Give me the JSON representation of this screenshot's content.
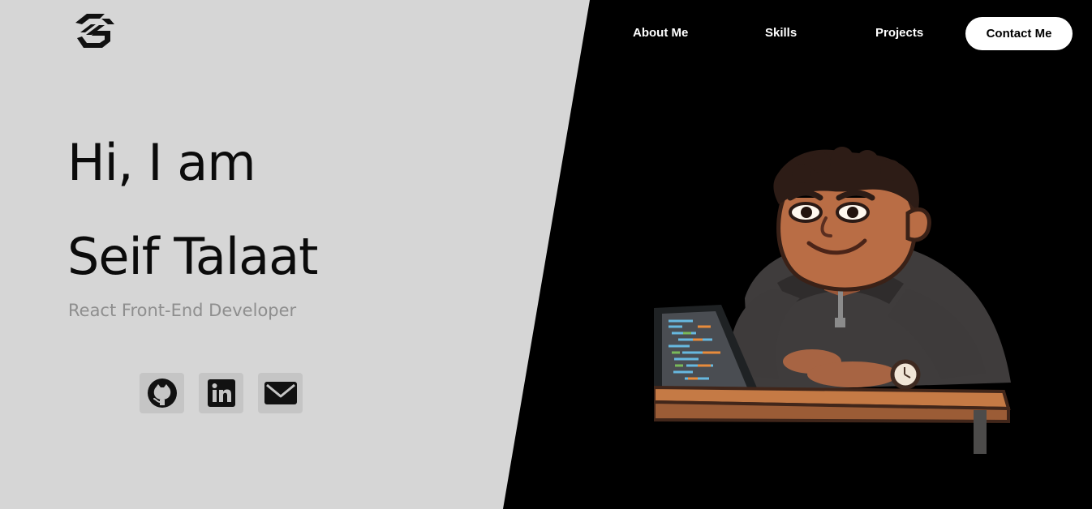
{
  "header": {
    "logo_icon": "tg-monogram-logo-icon",
    "nav": [
      {
        "label": "About Me"
      },
      {
        "label": "Skills"
      },
      {
        "label": "Projects"
      }
    ],
    "contact_label": "Contact Me"
  },
  "hero": {
    "greeting": "Hi, I am",
    "name": "Seif Talaat",
    "role": "React Front-End Developer",
    "socials": [
      {
        "icon": "github-icon"
      },
      {
        "icon": "linkedin-icon"
      },
      {
        "icon": "email-icon"
      }
    ],
    "illustration": "developer-avatar-illustration"
  },
  "colors": {
    "left_background": "#d6d6d6",
    "right_background": "#000000",
    "role_text": "#8e8e8e",
    "contact_button": "#ffffff"
  }
}
